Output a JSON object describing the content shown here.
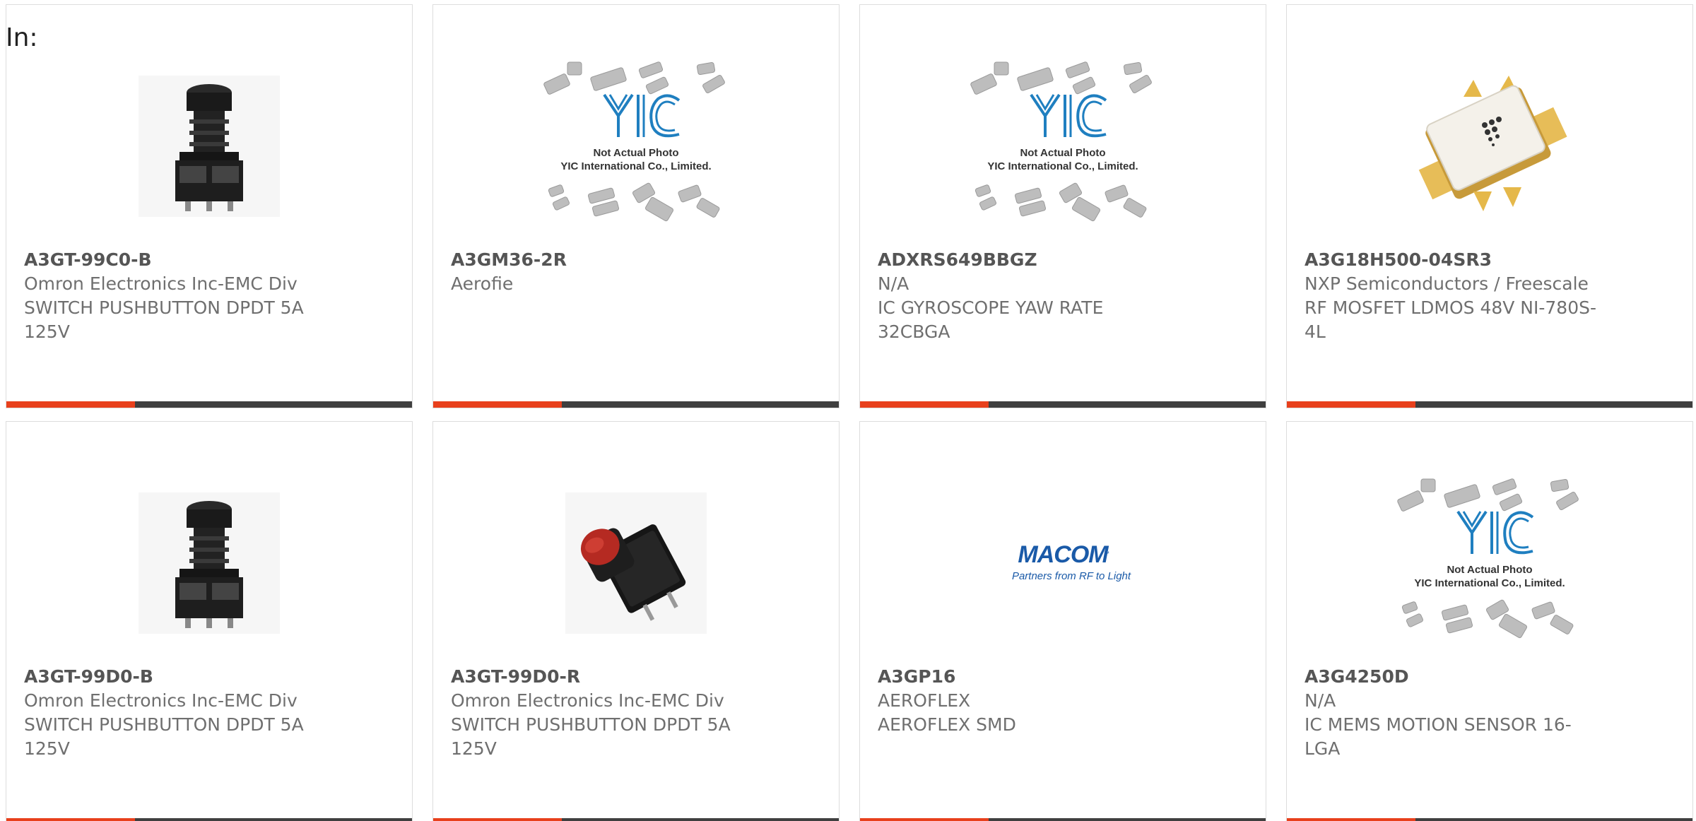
{
  "header": {
    "label": "In:"
  },
  "theme": {
    "accent": "#e8401c",
    "bar": "#3f3f3f",
    "text": "#6f6f6f"
  },
  "products": [
    {
      "part": "A3GT-99C0-B",
      "maker": "Omron Electronics Inc-EMC Div",
      "desc": "SWITCH PUSHBUTTON DPDT 5A 125V",
      "image": "black-pushbutton"
    },
    {
      "part": "A3GM36-2R",
      "maker": "Aerofie",
      "desc": "",
      "image": "yic-placeholder"
    },
    {
      "part": "ADXRS649BBGZ",
      "maker": "N/A",
      "desc": "IC GYROSCOPE YAW RATE 32CBGA",
      "image": "yic-placeholder"
    },
    {
      "part": "A3G18H500-04SR3",
      "maker": "NXP Semiconductors / Freescale",
      "desc": "RF MOSFET LDMOS 48V NI-780S-4L",
      "image": "rf-mosfet"
    },
    {
      "part": "A3GT-99D0-B",
      "maker": "Omron Electronics Inc-EMC Div",
      "desc": "SWITCH PUSHBUTTON DPDT 5A 125V",
      "image": "black-pushbutton"
    },
    {
      "part": "A3GT-99D0-R",
      "maker": "Omron Electronics Inc-EMC Div",
      "desc": "SWITCH PUSHBUTTON DPDT 5A 125V",
      "image": "red-pushbutton"
    },
    {
      "part": "A3GP16",
      "maker": "AEROFLEX",
      "desc": "AEROFLEX SMD",
      "image": "macom-logo"
    },
    {
      "part": "A3G4250D",
      "maker": "N/A",
      "desc": "IC MEMS MOTION SENSOR 16-LGA",
      "image": "yic-placeholder"
    }
  ],
  "placeholder": {
    "line1": "Not Actual Photo",
    "line2": "YIC International Co., Limited.",
    "logo": "YIC"
  },
  "macom": {
    "brand": "MACOM",
    "tagline": "Partners from RF to Light"
  }
}
